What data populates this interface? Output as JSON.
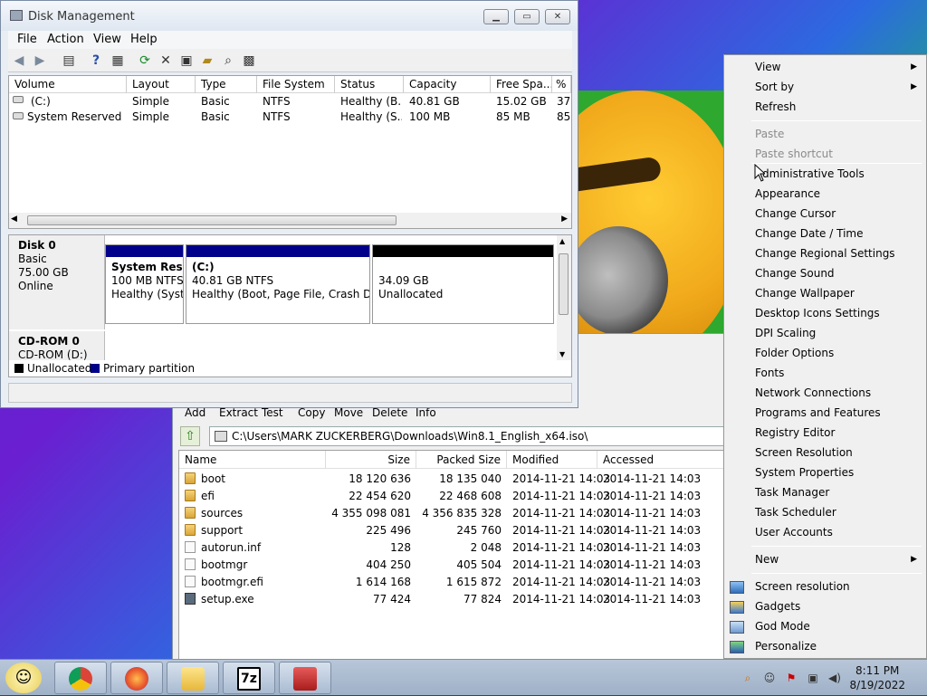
{
  "disk_mgmt": {
    "title": "Disk Management",
    "menu": [
      "File",
      "Action",
      "View",
      "Help"
    ],
    "columns": [
      "Volume",
      "Layout",
      "Type",
      "File System",
      "Status",
      "Capacity",
      "Free Spa...",
      "% F"
    ],
    "volumes": [
      {
        "volume": "(C:)",
        "layout": "Simple",
        "type": "Basic",
        "fs": "NTFS",
        "status": "Healthy (B...",
        "capacity": "40.81 GB",
        "free": "15.02 GB",
        "pct": "37"
      },
      {
        "volume": "System Reserved",
        "layout": "Simple",
        "type": "Basic",
        "fs": "NTFS",
        "status": "Healthy (S...",
        "capacity": "100 MB",
        "free": "85 MB",
        "pct": "85"
      }
    ],
    "disk0": {
      "name": "Disk 0",
      "type": "Basic",
      "size": "75.00 GB",
      "state": "Online"
    },
    "partitions": [
      {
        "title": "System Reser",
        "size": "100 MB NTFS",
        "status": "Healthy (Syste"
      },
      {
        "title": "(C:)",
        "size": "40.81 GB NTFS",
        "status": "Healthy (Boot, Page File, Crash Dum"
      },
      {
        "title": "",
        "size": "34.09 GB",
        "status": "Unallocated"
      }
    ],
    "cdrom": {
      "name": "CD-ROM 0",
      "drive": "CD-ROM (D:)"
    },
    "legend": {
      "unallocated": "Unallocated",
      "primary": "Primary partition"
    }
  },
  "zip": {
    "menu": [
      "Add",
      "Extract",
      "Test",
      "Copy",
      "Move",
      "Delete",
      "Info"
    ],
    "path": "C:\\Users\\MARK ZUCKERBERG\\Downloads\\Win8.1_English_x64.iso\\",
    "columns": [
      "Name",
      "Size",
      "Packed Size",
      "Modified",
      "Accessed"
    ],
    "files": [
      {
        "name": "boot",
        "size": "18 120 636",
        "packed": "18 135 040",
        "modified": "2014-11-21 14:03",
        "accessed": "2014-11-21 14:03",
        "kind": "folder"
      },
      {
        "name": "efi",
        "size": "22 454 620",
        "packed": "22 468 608",
        "modified": "2014-11-21 14:03",
        "accessed": "2014-11-21 14:03",
        "kind": "folder"
      },
      {
        "name": "sources",
        "size": "4 355 098 081",
        "packed": "4 356 835 328",
        "modified": "2014-11-21 14:03",
        "accessed": "2014-11-21 14:03",
        "kind": "folder"
      },
      {
        "name": "support",
        "size": "225 496",
        "packed": "245 760",
        "modified": "2014-11-21 14:03",
        "accessed": "2014-11-21 14:03",
        "kind": "folder"
      },
      {
        "name": "autorun.inf",
        "size": "128",
        "packed": "2 048",
        "modified": "2014-11-21 14:03",
        "accessed": "2014-11-21 14:03",
        "kind": "file"
      },
      {
        "name": "bootmgr",
        "size": "404 250",
        "packed": "405 504",
        "modified": "2014-11-21 14:03",
        "accessed": "2014-11-21 14:03",
        "kind": "file"
      },
      {
        "name": "bootmgr.efi",
        "size": "1 614 168",
        "packed": "1 615 872",
        "modified": "2014-11-21 14:03",
        "accessed": "2014-11-21 14:03",
        "kind": "file"
      },
      {
        "name": "setup.exe",
        "size": "77 424",
        "packed": "77 824",
        "modified": "2014-11-21 14:03",
        "accessed": "2014-11-21 14:03",
        "kind": "exe"
      }
    ]
  },
  "context_menu": {
    "view": "View",
    "sort_by": "Sort by",
    "refresh": "Refresh",
    "paste": "Paste",
    "paste_shortcut": "Paste shortcut",
    "tools": [
      "Administrative Tools",
      "Appearance",
      "Change Cursor",
      "Change Date / Time",
      "Change Regional Settings",
      "Change Sound",
      "Change Wallpaper",
      "Desktop Icons Settings",
      "DPI Scaling",
      "Folder Options",
      "Fonts",
      "Network Connections",
      "Programs and Features",
      "Registry Editor",
      "Screen Resolution",
      "System Properties",
      "Task Manager",
      "Task Scheduler",
      "User Accounts"
    ],
    "new": "New",
    "extras": [
      "Screen resolution",
      "Gadgets",
      "God Mode",
      "Personalize"
    ]
  },
  "taskbar": {
    "zip_label": "7z",
    "time": "8:11 PM",
    "date": "8/19/2022"
  }
}
